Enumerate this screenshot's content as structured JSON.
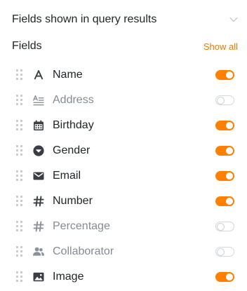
{
  "panel": {
    "title": "Fields shown in query results",
    "fields_label": "Fields",
    "show_all_label": "Show all"
  },
  "colors": {
    "accent": "#ff8000",
    "link": "#e87b08",
    "text": "#212529",
    "disabled_text": "#858b94"
  },
  "fields": [
    {
      "label": "Name",
      "icon": "text-icon",
      "shown": true
    },
    {
      "label": "Address",
      "icon": "long-text-icon",
      "shown": false
    },
    {
      "label": "Birthday",
      "icon": "calendar-icon",
      "shown": true
    },
    {
      "label": "Gender",
      "icon": "single-select-icon",
      "shown": true
    },
    {
      "label": "Email",
      "icon": "email-icon",
      "shown": true
    },
    {
      "label": "Number",
      "icon": "number-icon",
      "shown": true
    },
    {
      "label": "Percentage",
      "icon": "number-icon",
      "shown": false
    },
    {
      "label": "Collaborator",
      "icon": "collaborator-icon",
      "shown": false
    },
    {
      "label": "Image",
      "icon": "image-icon",
      "shown": true
    }
  ]
}
